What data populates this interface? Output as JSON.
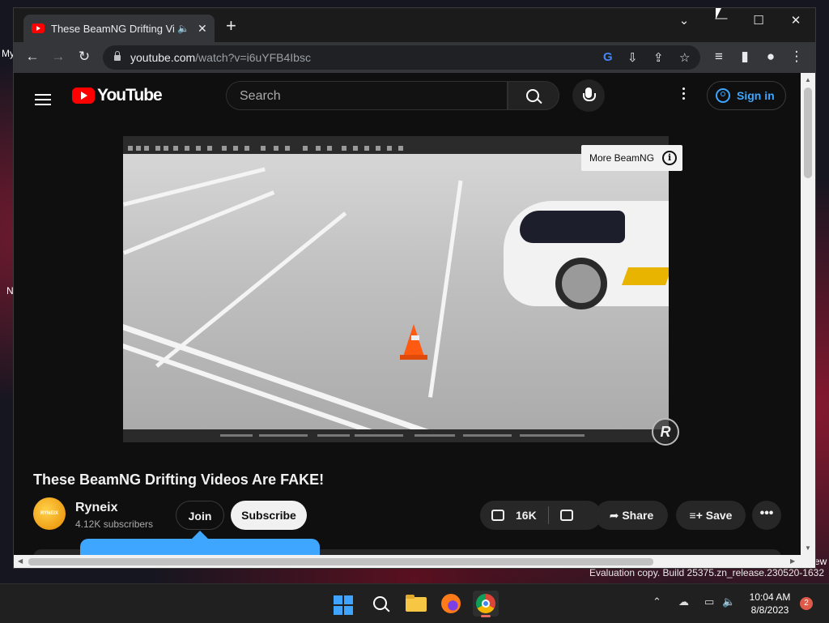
{
  "desktop": {
    "left_fragments": [
      "My",
      "N"
    ],
    "right_fragment": "ew",
    "evaluation_text": "Evaluation copy. Build 25375.zn_release.230520-1632"
  },
  "browser": {
    "tab": {
      "title": "These BeamNG Drifting Vide",
      "audio_icon": "speaker-icon",
      "close": "✕"
    },
    "new_tab": "+",
    "window_controls": {
      "collapse": "⌄",
      "minimize": "—",
      "maximize": "☐",
      "close": "✕"
    },
    "address": {
      "host": "youtube.com",
      "path": "/watch?v=i6uYFB4Ibsc"
    }
  },
  "youtube": {
    "logo_text": "YouTube",
    "search_placeholder": "Search",
    "sign_in": "Sign in",
    "more_videos_label": "More BeamNG",
    "info_glyph": "i",
    "watermark": "R",
    "video_title": "These BeamNG Drifting Videos Are FAKE!",
    "channel": {
      "avatar_text": "RYNEIX",
      "name": "Ryneix",
      "subscribers": "4.12K subscribers"
    },
    "actions": {
      "join": "Join",
      "subscribe": "Subscribe",
      "likes": "16K",
      "share": "Share",
      "save": "Save",
      "more": "•••"
    }
  },
  "taskbar": {
    "apps": [
      "start",
      "search",
      "file-explorer",
      "firefox",
      "chrome"
    ],
    "clock_time": "10:04 AM",
    "clock_date": "8/8/2023",
    "notification_count": "2"
  },
  "colors": {
    "yt_red": "#ff0000",
    "link_blue": "#3ea6ff",
    "yt_bg": "#0f0f0f",
    "chrome_toolbar": "#35363a"
  }
}
